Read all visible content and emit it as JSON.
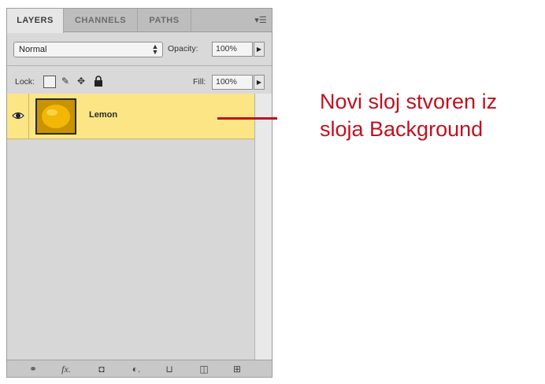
{
  "panel": {
    "tabs": [
      {
        "label": "LAYERS",
        "active": true
      },
      {
        "label": "CHANNELS",
        "active": false
      },
      {
        "label": "PATHS",
        "active": false
      }
    ],
    "menu_icon": "panel-menu-icon",
    "blend_mode": "Normal",
    "opacity_label": "Opacity:",
    "opacity_value": "100%",
    "lock_label": "Lock:",
    "fill_label": "Fill:",
    "fill_value": "100%"
  },
  "layers": [
    {
      "name": "Lemon",
      "visible": true,
      "selected": true
    }
  ],
  "footer_icons": [
    "link-layers-icon",
    "fx-icon",
    "add-mask-icon",
    "adjustment-layer-icon",
    "new-group-icon",
    "new-layer-icon",
    "trash-icon"
  ],
  "footer": {
    "fx_label": "fx."
  },
  "annotation": {
    "line1": "Novi sloj stvoren iz",
    "line2": "sloja Background"
  },
  "colors": {
    "selected_row": "#fbe585",
    "annotation": "#c0111f",
    "panel_bg": "#d9d9d9"
  }
}
